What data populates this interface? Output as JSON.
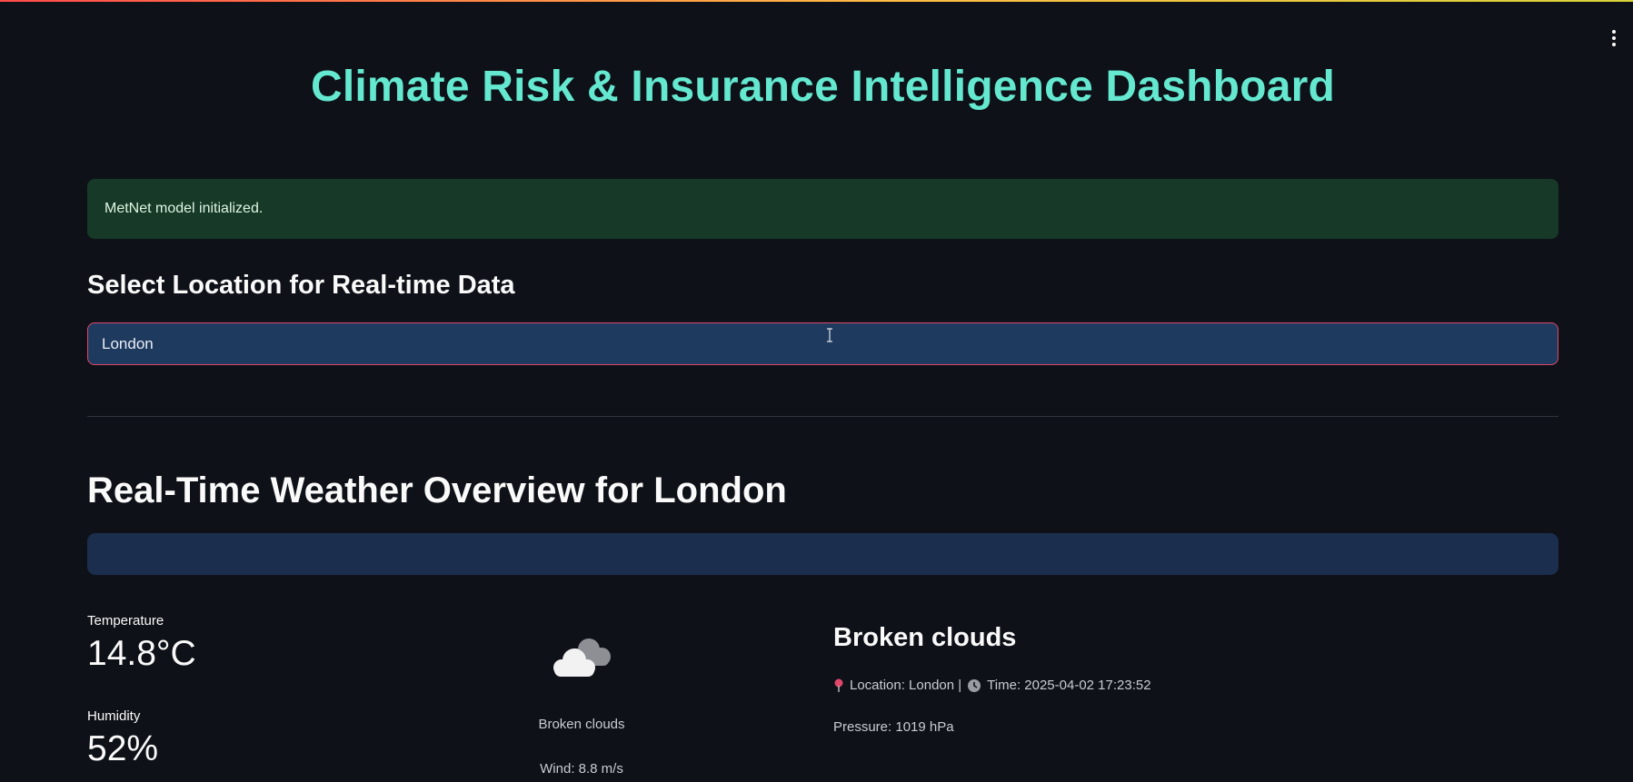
{
  "header": {
    "title": "Climate Risk & Insurance Intelligence Dashboard"
  },
  "alert": {
    "message": "MetNet model initialized."
  },
  "location": {
    "label": "Select Location for Real-time Data",
    "value": "London"
  },
  "weather": {
    "heading": "Real-Time Weather Overview for London",
    "temperature_label": "Temperature",
    "temperature_value": "14.8°C",
    "humidity_label": "Humidity",
    "humidity_value": "52%",
    "icon": "cloud-icon",
    "icon_caption": "Broken clouds",
    "wind": "Wind: 8.8 m/s",
    "condition": "Broken clouds",
    "location_text": "Location: London |",
    "time_text": "Time: 2025-04-02 17:23:52",
    "pressure": "Pressure: 1019 hPa"
  },
  "colors": {
    "background": "#0e1117",
    "title_accent": "#64e8cf",
    "success_bg": "#173928",
    "input_bg": "#1e3a5f",
    "input_border": "#e0476a",
    "bar_bg": "#1c2e4d"
  }
}
